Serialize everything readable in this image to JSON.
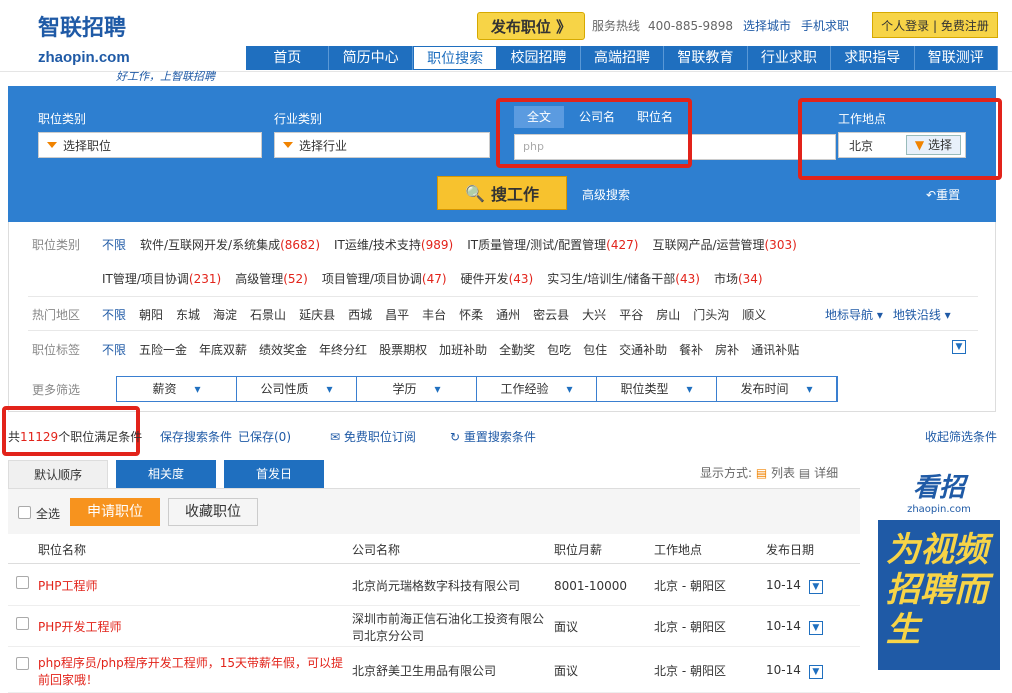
{
  "brand": {
    "logo": "智联招聘",
    "domain": "zhaopin.com",
    "slogan": "好工作，上智联招聘"
  },
  "top": {
    "publish": "发布职位 》",
    "hotline_label": "服务热线",
    "hotline": "400-885-9898",
    "city": "选择城市",
    "mobile": "手机求职",
    "login": "个人登录 | 免费注册"
  },
  "nav": [
    "首页",
    "简历中心",
    "职位搜索",
    "校园招聘",
    "高端招聘",
    "智联教育",
    "行业求职",
    "求职指导",
    "智联测评"
  ],
  "search": {
    "job_label": "职位类别",
    "job_ph": "选择职位",
    "ind_label": "行业类别",
    "ind_ph": "选择行业",
    "modes": [
      "全文",
      "公司名",
      "职位名"
    ],
    "keyword": "php",
    "loc_label": "工作地点",
    "loc": "北京",
    "loc_btn": "选择",
    "submit": "搜工作",
    "advanced": "高级搜索",
    "reset": "重置"
  },
  "filter": {
    "cat_label": "职位类别",
    "unlimited": "不限",
    "cats1": [
      [
        "软件/互联网开发/系统集成",
        "8682"
      ],
      [
        "IT运维/技术支持",
        "989"
      ],
      [
        "IT质量管理/测试/配置管理",
        "427"
      ],
      [
        "互联网产品/运营管理",
        "303"
      ]
    ],
    "cats2": [
      [
        "IT管理/项目协调",
        "231"
      ],
      [
        "高级管理",
        "52"
      ],
      [
        "项目管理/项目协调",
        "47"
      ],
      [
        "硬件开发",
        "43"
      ],
      [
        "实习生/培训生/储备干部",
        "43"
      ],
      [
        "市场",
        "34"
      ]
    ],
    "area_label": "热门地区",
    "areas": [
      "朝阳",
      "东城",
      "海淀",
      "石景山",
      "延庆县",
      "西城",
      "昌平",
      "丰台",
      "怀柔",
      "通州",
      "密云县",
      "大兴",
      "平谷",
      "房山",
      "门头沟",
      "顺义"
    ],
    "area_links": [
      "地标导航",
      "地铁沿线"
    ],
    "tag_label": "职位标签",
    "tags": [
      "五险一金",
      "年底双薪",
      "绩效奖金",
      "年终分红",
      "股票期权",
      "加班补助",
      "全勤奖",
      "包吃",
      "包住",
      "交通补助",
      "餐补",
      "房补",
      "通讯补贴"
    ],
    "more_label": "更多筛选",
    "more": [
      "薪资",
      "公司性质",
      "学历",
      "工作经验",
      "职位类型",
      "发布时间"
    ]
  },
  "result": {
    "prefix": "共",
    "count": "11129",
    "suffix": "个职位满足条件",
    "save": "保存搜索条件",
    "saved": "已保存(0)",
    "subscribe": "免费职位订阅",
    "reset": "重置搜索条件",
    "collapse": "收起筛选条件"
  },
  "sort": [
    "默认顺序",
    "相关度",
    "首发日"
  ],
  "display": {
    "label": "显示方式:",
    "list": "列表",
    "detail": "详细"
  },
  "actions": {
    "all": "全选",
    "apply": "申请职位",
    "fav": "收藏职位"
  },
  "cols": [
    "职位名称",
    "公司名称",
    "职位月薪",
    "工作地点",
    "发布日期"
  ],
  "rows": [
    {
      "title": "PHP工程师",
      "company": "北京尚元瑞格数字科技有限公司",
      "salary": "8001-10000",
      "loc": "北京 - 朝阳区",
      "date": "10-14"
    },
    {
      "title": "PHP开发工程师",
      "company": "深圳市前海正信石油化工投资有限公司北京分公司",
      "salary": "面议",
      "loc": "北京 - 朝阳区",
      "date": "10-14"
    },
    {
      "title": "php程序员/php程序开发工程师，15天带薪年假，可以提前回家哦！",
      "company": "北京舒美卫生用品有限公司",
      "salary": "面议",
      "loc": "北京 - 朝阳区",
      "date": "10-14"
    }
  ],
  "ad": {
    "logo": "看招",
    "domain": "zhaopin.com",
    "text": "为视频招聘而生"
  }
}
